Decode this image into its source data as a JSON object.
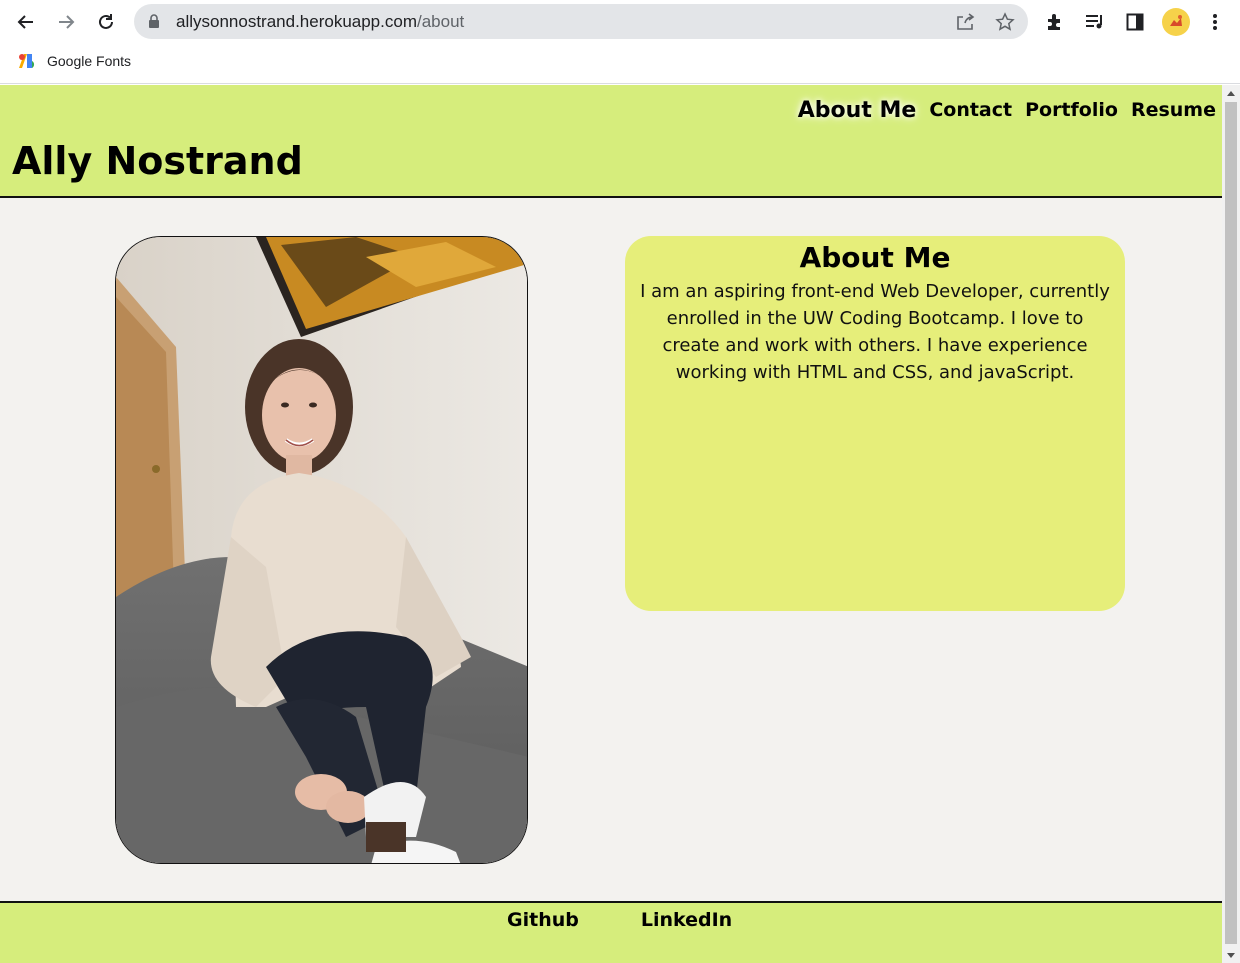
{
  "browser": {
    "url_host": "allysonnostrand.herokuapp.com",
    "url_path": "/about",
    "bookmark_label": "Google Fonts"
  },
  "header": {
    "title": "Ally Nostrand",
    "nav": [
      {
        "label": "About Me",
        "active": true
      },
      {
        "label": "Contact",
        "active": false
      },
      {
        "label": "Portfolio",
        "active": false
      },
      {
        "label": "Resume",
        "active": false
      }
    ]
  },
  "about": {
    "heading": "About Me",
    "text": "I am an aspiring front-end Web Developer, currently enrolled in the UW Coding Bootcamp. I love to create and work with others. I have experience working with HTML and CSS, and javaScript."
  },
  "footer": {
    "links": [
      {
        "label": "Github"
      },
      {
        "label": "LinkedIn"
      }
    ]
  },
  "colors": {
    "header_bg": "#d6ed7c",
    "card_bg": "#e6ee7a",
    "page_bg": "#f3f2ef"
  }
}
